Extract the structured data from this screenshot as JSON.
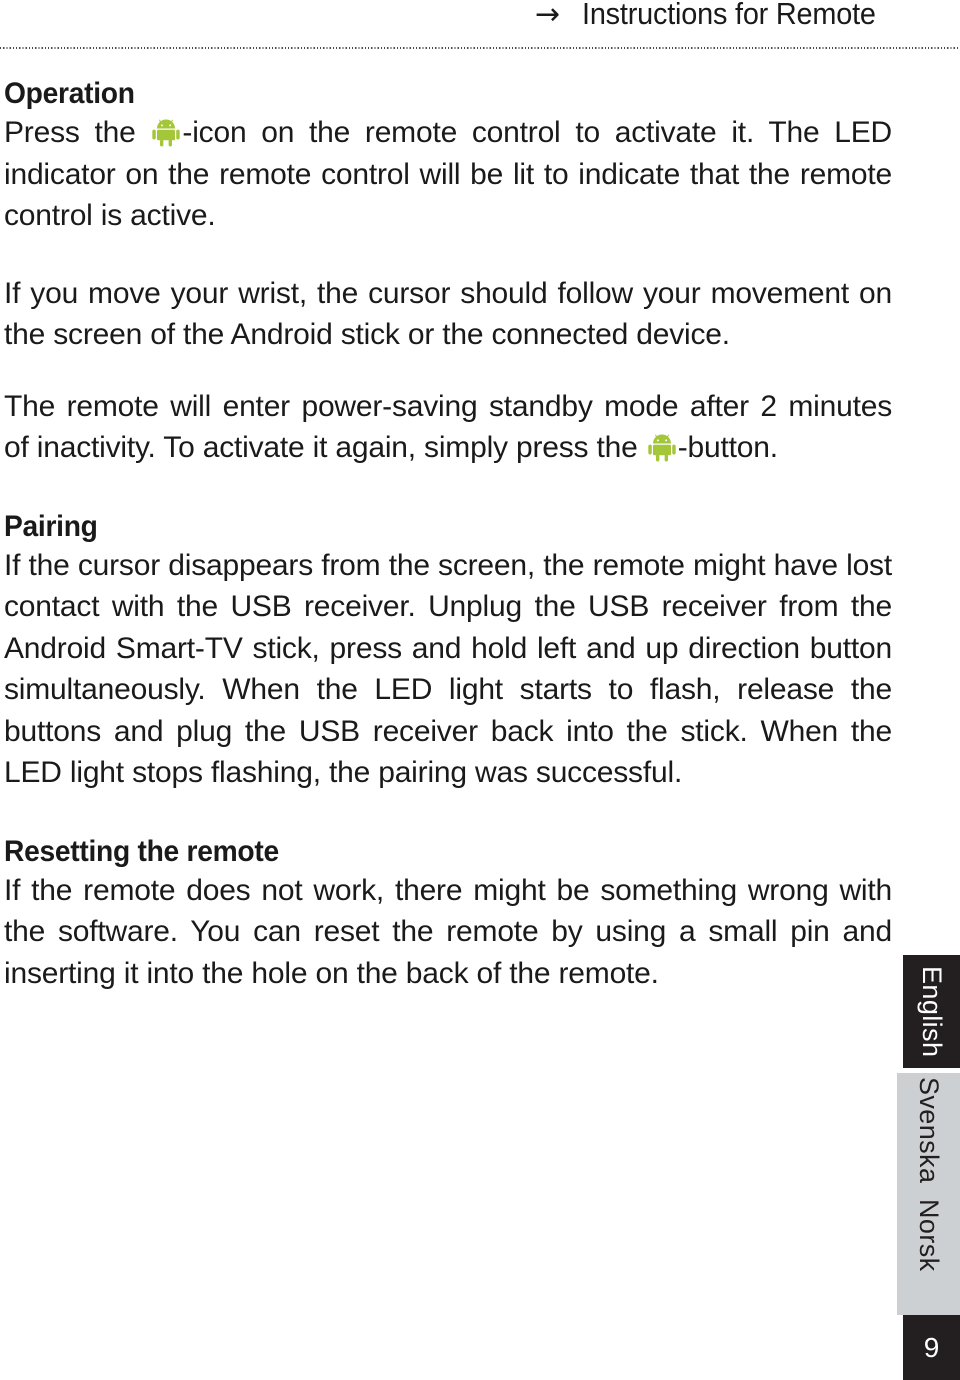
{
  "header": {
    "arrow_icon": "arrow-right",
    "title": "Instructions for Remote"
  },
  "sections": [
    {
      "heading": "Operation",
      "paragraphs": [
        {
          "lines": [
            "Press the  -icon on the remote control to activate it. The",
            "LED indicator on the remote control will be lit to indicate that",
            "the remote control is active."
          ],
          "text": "Press the [android]-icon on the remote control to activate it. The LED indicator on the remote control will be lit to indicate that the remote control is active.",
          "inline_icon": "android-robot-icon"
        },
        {
          "text": "If you move your wrist, the cursor should follow your movement on the screen of the Android stick or the connected device."
        },
        {
          "text_before_icon": "The remote will enter power-saving standby mode after 2 minutes of inactivity. To activate it again, simply press the ",
          "text_after_icon": "-button.",
          "inline_icon": "android-robot-icon"
        }
      ]
    },
    {
      "heading": "Pairing",
      "paragraphs": [
        {
          "text": "If the cursor disappears from the screen, the remote might have lost contact with the USB receiver. Unplug the USB receiver from the Android Smart-TV stick, press and hold left and up direction button simultaneously. When the LED light starts to flash, release the buttons and plug the USB receiver back into the stick. When the LED light stops flashing, the pairing was successful."
        }
      ]
    },
    {
      "heading": "Resetting the remote",
      "paragraphs": [
        {
          "text": "If the remote does not work, there might be something wrong with the software. You can reset the remote by using a small pin and inserting it into the hole on the back of the remote."
        }
      ]
    }
  ],
  "side_tabs": {
    "english": "English",
    "svenska": "Svenska",
    "norsk": "Norsk"
  },
  "page_number": "9",
  "colors": {
    "android_green": "#A4C639",
    "tab_dark": "#231f20",
    "tab_light": "#cdd0d2",
    "text": "#1a1a1a"
  }
}
